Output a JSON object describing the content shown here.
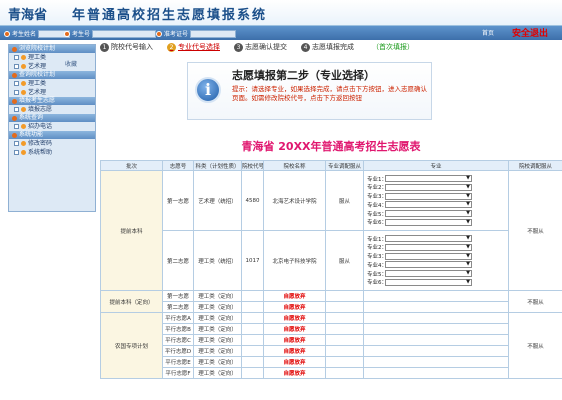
{
  "header": {
    "province": "青海省",
    "system_title": "年普通高校招生志愿填报系统",
    "candidate_label": "考生姓名",
    "exam_no_label": "考生号",
    "ticket_label": "准考证号",
    "home_label": "首页",
    "exit_label": "安全退出"
  },
  "sidebar": {
    "badge": "收藏",
    "sections": [
      {
        "title": "浏览院校计划",
        "items": [
          "理工类",
          "艺术理"
        ]
      },
      {
        "title": "查询院校计划",
        "items": [
          "理工类",
          "艺术理"
        ]
      },
      {
        "title": "填报考生志愿",
        "items": [
          "填报志愿"
        ]
      },
      {
        "title": "系统查询",
        "items": [
          "招办电话"
        ]
      },
      {
        "title": "系统功能",
        "items": [
          "修改密码",
          "系统帮助"
        ]
      }
    ]
  },
  "steps": [
    {
      "num": "1",
      "label": "院校代号输入",
      "active": false
    },
    {
      "num": "2",
      "label": "专业代号选择",
      "active": true
    },
    {
      "num": "3",
      "label": "志愿确认提交",
      "active": false
    },
    {
      "num": "4",
      "label": "志愿填报完成",
      "active": false
    }
  ],
  "first_fill": "（首次填报）",
  "notice": {
    "icon": "info-icon",
    "title": "志愿填报第二步（专业选择）",
    "text": "提示：请选择专业，如果选择完成，请点击下方按钮，进入志愿确认页面。如需修改院校代号，点击下方返回按钮"
  },
  "form_title": "青海省 20XX年普通高考招生志愿表",
  "table": {
    "headers": [
      "批次",
      "志愿号",
      "科类（计划性质）",
      "院校代号",
      "院校名称",
      "专业调配服从",
      "专业",
      "院校调配服从"
    ],
    "major_labels": [
      "专业1：",
      "专业2：",
      "专业3：",
      "专业4：",
      "专业5：",
      "专业6："
    ],
    "batch1": "提前本科",
    "batch1_rows": [
      {
        "order": "第一志愿",
        "category": "艺术理（统招）",
        "code": "4580",
        "school": "北海艺术设计学院",
        "obey": "服从"
      },
      {
        "order": "第二志愿",
        "category": "理工类（统招）",
        "code": "1017",
        "school": "北京电子科技学院",
        "obey": "服从"
      }
    ],
    "batch1_school_obey": "不服从",
    "batch2": "提前本科（定向）",
    "batch2_rows": [
      {
        "order": "第一志愿",
        "category": "理工类（定向）",
        "status": "自愿放弃"
      },
      {
        "order": "第二志愿",
        "category": "理工类（定向）",
        "status": "自愿放弃"
      }
    ],
    "batch2_school_obey": "不服从",
    "batch3": "农国专项计划",
    "batch3_rows": [
      {
        "order": "平行志愿A",
        "category": "理工类（定向）",
        "status": "自愿放弃"
      },
      {
        "order": "平行志愿B",
        "category": "理工类（定向）",
        "status": "自愿放弃"
      },
      {
        "order": "平行志愿C",
        "category": "理工类（定向）",
        "status": "自愿放弃"
      },
      {
        "order": "平行志愿D",
        "category": "理工类（定向）",
        "status": "自愿放弃"
      },
      {
        "order": "平行志愿E",
        "category": "理工类（定向）",
        "status": "自愿放弃"
      },
      {
        "order": "平行志愿F",
        "category": "理工类（定向）",
        "status": "自愿放弃"
      }
    ],
    "batch3_school_obey": "不服从"
  },
  "colors": {
    "accent": "#e0176f",
    "notice_text": "#cc2200",
    "header_blue": "#3d6faa",
    "exit_red": "#e00000"
  }
}
